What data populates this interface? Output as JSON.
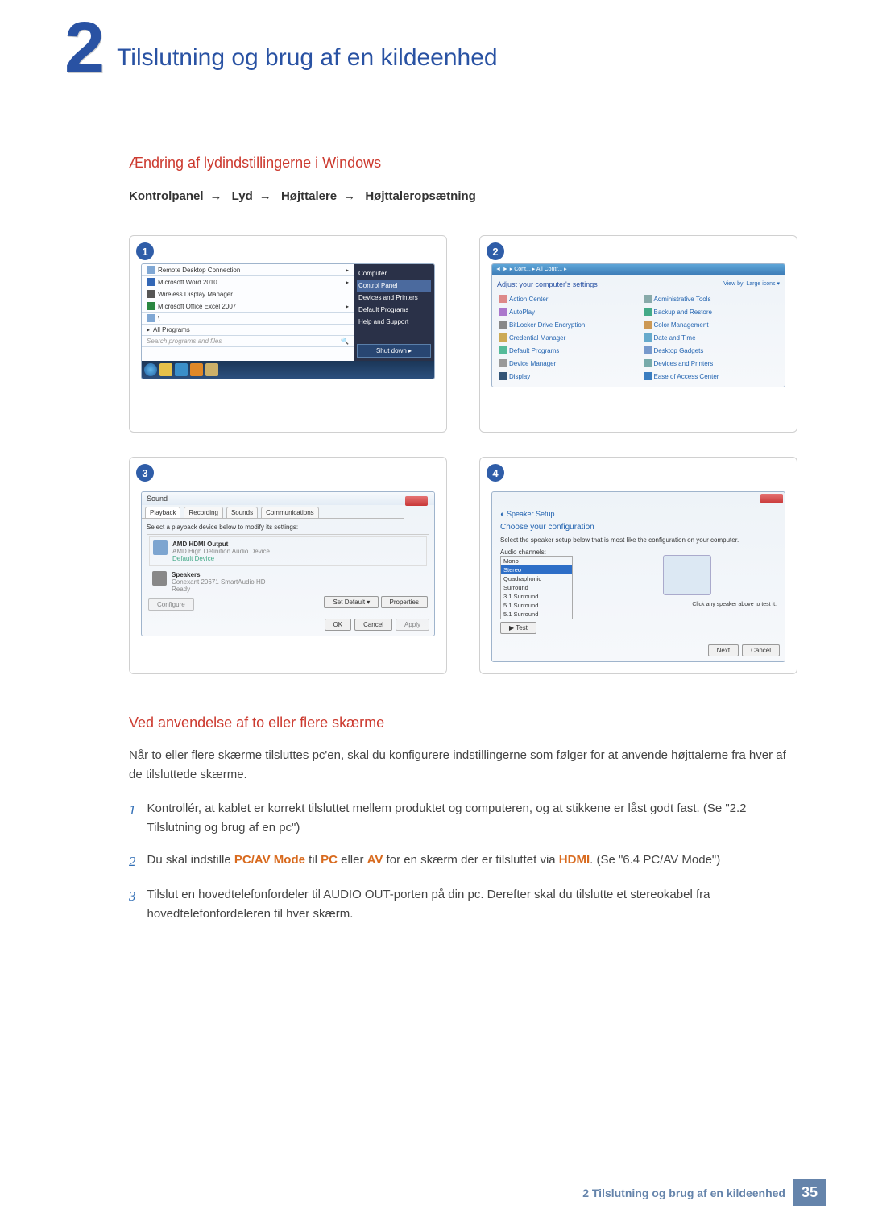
{
  "chapter": {
    "number": "2",
    "title": "Tilslutning og brug af en kildeenhed"
  },
  "section1": {
    "heading": "Ændring af lydindstillingerne i Windows",
    "path": [
      "Kontrolpanel",
      "Lyd",
      "Højttalere",
      "Højttaleropsætning"
    ],
    "arrow": "→"
  },
  "steps": {
    "s1": "1",
    "s2": "2",
    "s3": "3",
    "s4": "4"
  },
  "start_menu": {
    "left": [
      "Remote Desktop Connection",
      "Microsoft Word 2010",
      "Wireless Display Manager",
      "Microsoft Office Excel 2007",
      "\\",
      "All Programs"
    ],
    "search": "Search programs and files",
    "right": [
      "Computer",
      "Control Panel",
      "Devices and Printers",
      "Default Programs",
      "Help and Support"
    ],
    "shutdown": "Shut down"
  },
  "control_panel": {
    "title": "Adjust your computer's settings",
    "viewby": "View by:   Large icons ▾",
    "items": [
      "Action Center",
      "Administrative Tools",
      "AutoPlay",
      "Backup and Restore",
      "BitLocker Drive Encryption",
      "Color Management",
      "Credential Manager",
      "Date and Time",
      "Default Programs",
      "Desktop Gadgets",
      "Device Manager",
      "Devices and Printers",
      "Display",
      "Ease of Access Center"
    ]
  },
  "sound": {
    "title": "Sound",
    "tabs": [
      "Playback",
      "Recording",
      "Sounds",
      "Communications"
    ],
    "prompt": "Select a playback device below to modify its settings:",
    "dev1": {
      "name": "AMD HDMI Output",
      "sub": "AMD High Definition Audio Device",
      "status": "Default Device"
    },
    "dev2": {
      "name": "Speakers",
      "sub": "Conexant 20671 SmartAudio HD",
      "status": "Ready"
    },
    "buttons": {
      "configure": "Configure",
      "setdefault": "Set Default  ▾",
      "properties": "Properties",
      "ok": "OK",
      "cancel": "Cancel",
      "apply": "Apply"
    }
  },
  "speaker_setup": {
    "title": "Speaker Setup",
    "heading": "Choose your configuration",
    "prompt": "Select the speaker setup below that is most like the configuration on your computer.",
    "label": "Audio channels:",
    "options": [
      "Mono",
      "Stereo",
      "Quadraphonic",
      "Surround",
      "3.1 Surround",
      "5.1 Surround",
      "5.1 Surround"
    ],
    "test": "▶ Test",
    "hint": "Click any speaker above to test it.",
    "next": "Next",
    "cancel": "Cancel"
  },
  "section2": {
    "heading": "Ved anvendelse af to eller flere skærme",
    "intro": "Når to eller flere skærme tilsluttes pc'en, skal du konfigurere indstillingerne som følger for at anvende højttalerne fra hver af de tilsluttede skærme.",
    "li1_num": "1",
    "li1": "Kontrollér, at kablet er korrekt tilsluttet mellem produktet og computeren, og at stikkene er låst godt fast. (Se \"2.2 Tilslutning og brug af en pc\")",
    "li2_num": "2",
    "li2_a": "Du skal indstille ",
    "li2_pcav": "PC/AV Mode",
    "li2_b": " til ",
    "li2_pc": "PC",
    "li2_c": " eller ",
    "li2_av": "AV",
    "li2_d": " for en skærm der er tilsluttet via ",
    "li2_hdmi": "HDMI",
    "li2_e": ". (Se \"6.4 PC/AV Mode\")",
    "li3_num": "3",
    "li3": "Tilslut en hovedtelefonfordeler til AUDIO OUT-porten på din pc. Derefter skal du tilslutte et stereokabel fra hovedtelefonfordeleren til hver skærm."
  },
  "footer": {
    "text_pre": "2 Tilslutning og brug af en kildeenhed",
    "page": "35"
  }
}
